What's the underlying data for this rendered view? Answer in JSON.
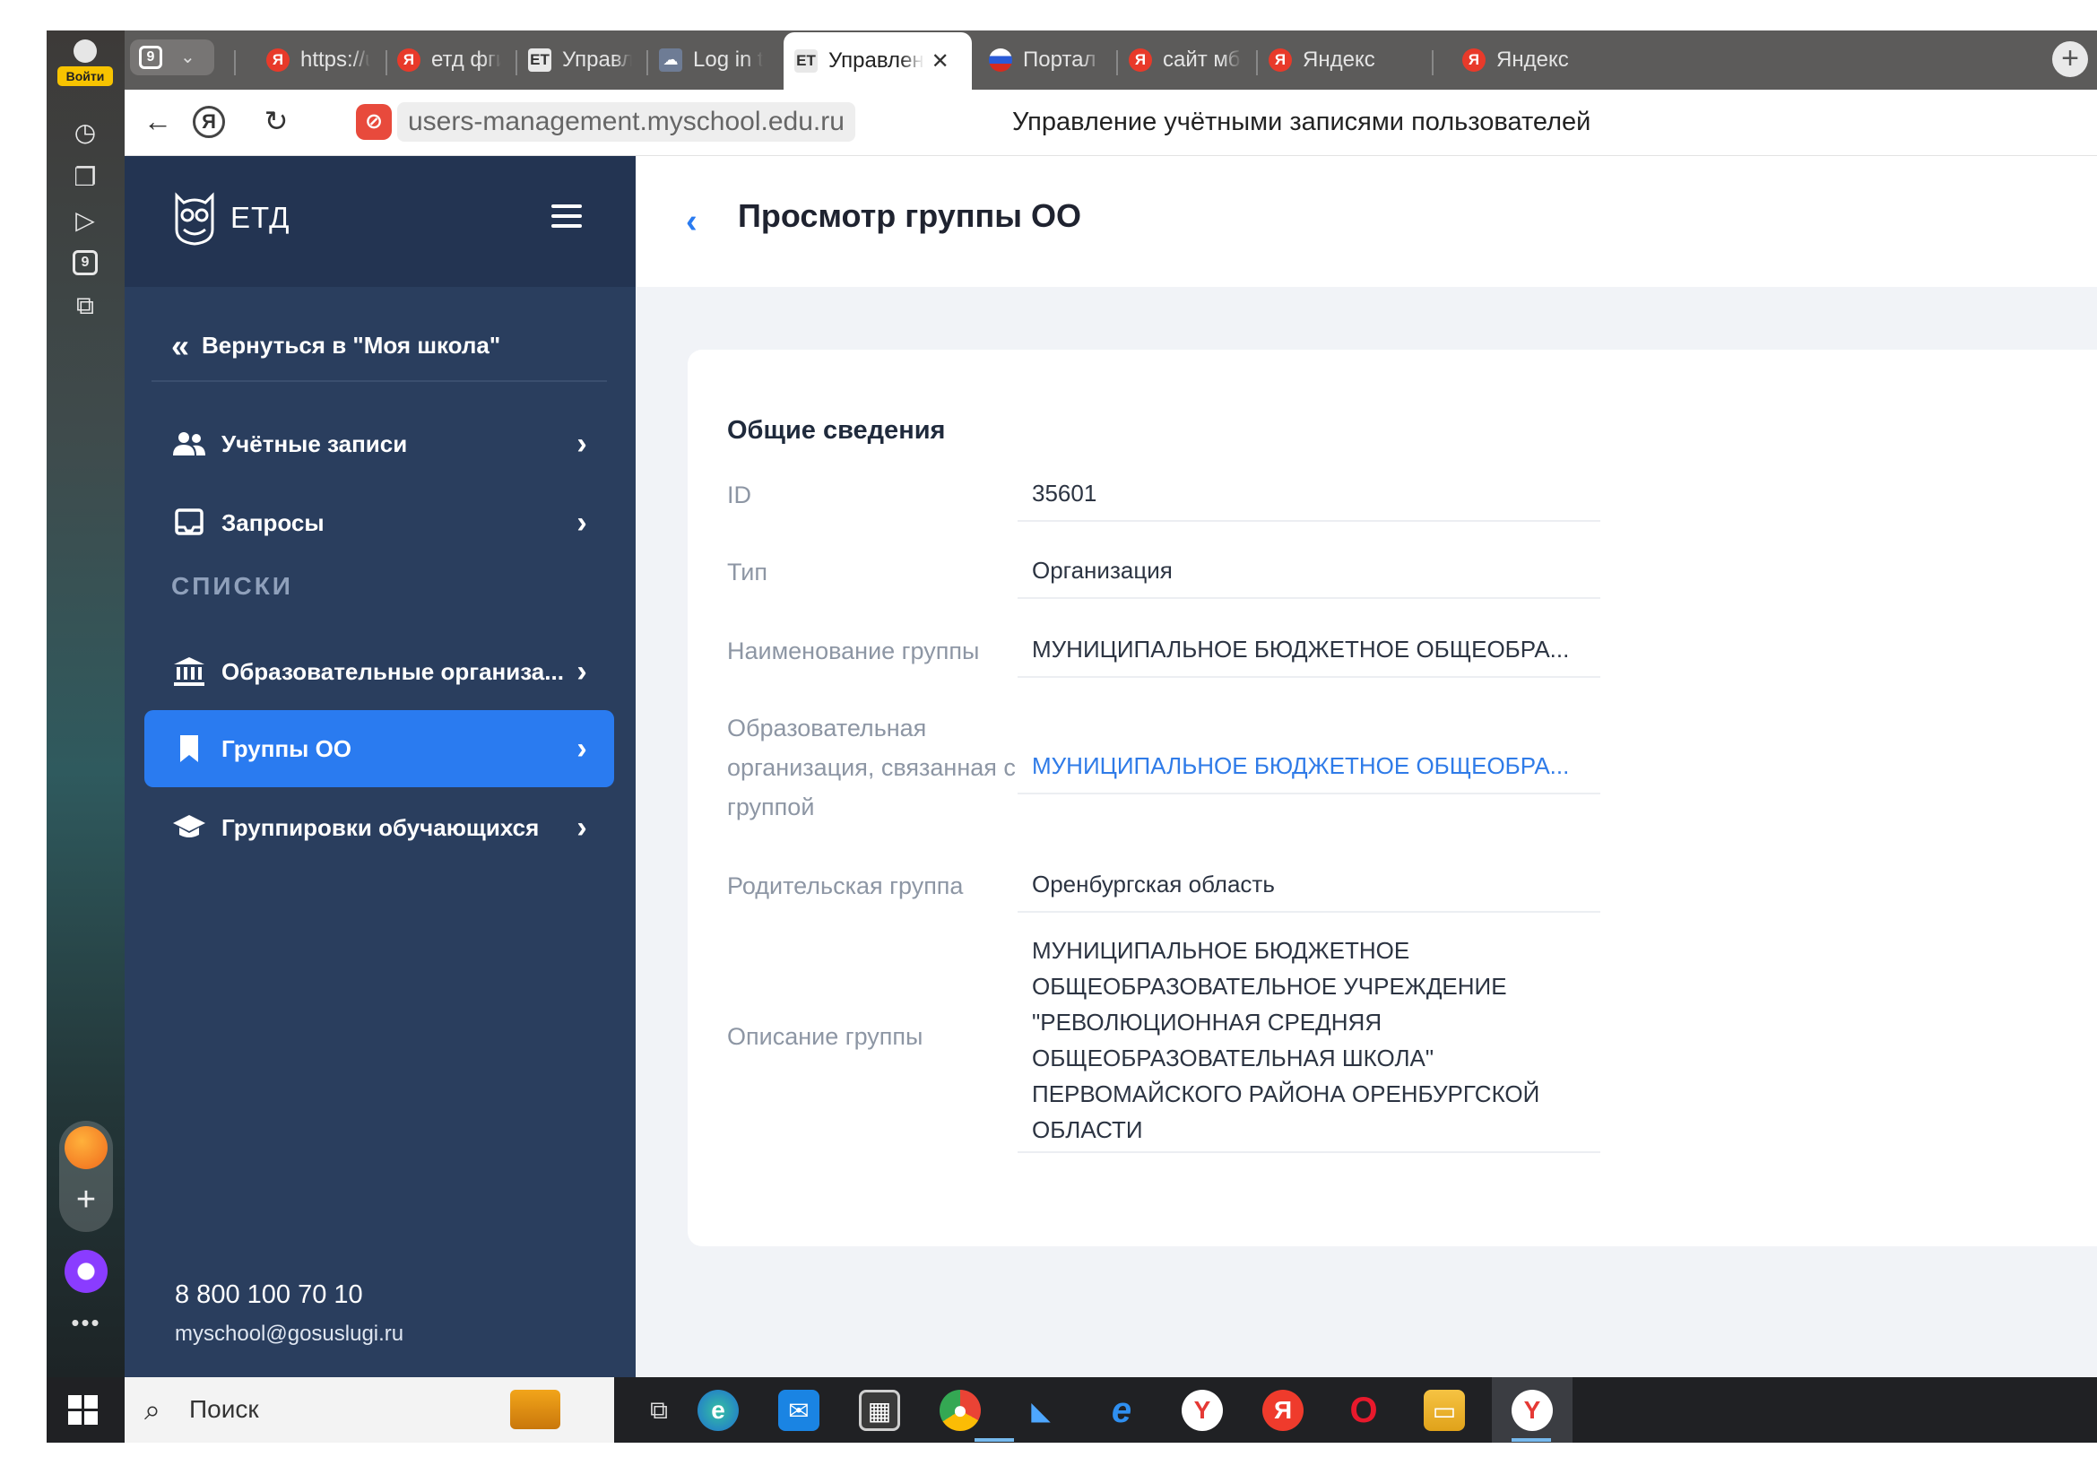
{
  "rail": {
    "login_label": "Войти",
    "tabs_count": "9",
    "icons": [
      "history-icon",
      "collections-icon",
      "video-icon",
      "counter-icon",
      "screenshot-icon"
    ]
  },
  "tabs": [
    {
      "title": "https://users",
      "favicon": "ya"
    },
    {
      "title": "етд фгис мо",
      "favicon": "ya"
    },
    {
      "title": "Управление",
      "favicon": "doc"
    },
    {
      "title": "Log in to etd",
      "favicon": "cloud"
    },
    {
      "title": "Управлен",
      "favicon": "doc",
      "active": true
    },
    {
      "title": "Портал госу",
      "favicon": "ru"
    },
    {
      "title": "сайт мбоу с",
      "favicon": "ya"
    },
    {
      "title": "Яндекс",
      "favicon": "ya"
    },
    {
      "title": "Яндекс",
      "favicon": "ya"
    }
  ],
  "address": {
    "url": "users-management.myschool.edu.ru",
    "page_title": "Управление учётными записями пользователей"
  },
  "sidebar": {
    "logo": "ЕТД",
    "back": "Вернуться в \"Моя школа\"",
    "items": [
      {
        "label": "Учётные записи",
        "icon": "users-icon"
      },
      {
        "label": "Запросы",
        "icon": "inbox-icon"
      }
    ],
    "section": "СПИСКИ",
    "lists": [
      {
        "label": "Образовательные организа...",
        "icon": "institution-icon"
      },
      {
        "label": "Группы ОО",
        "icon": "bookmark-icon",
        "active": true
      },
      {
        "label": "Группировки обучающихся",
        "icon": "graduation-cap-icon"
      }
    ],
    "phone": "8 800 100 70 10",
    "email": "myschool@gosuslugi.ru"
  },
  "main": {
    "title": "Просмотр группы ОО",
    "card_title": "Общие сведения",
    "rows": [
      {
        "label": "ID",
        "value": "35601"
      },
      {
        "label": "Тип",
        "value": "Организация"
      },
      {
        "label": "Наименование группы",
        "value": "МУНИЦИПАЛЬНОЕ БЮДЖЕТНОЕ ОБЩЕОБРА..."
      },
      {
        "label": "Образовательная организация, связанная с группой",
        "value": "МУНИЦИПАЛЬНОЕ БЮДЖЕТНОЕ ОБЩЕОБРА...",
        "link": true
      },
      {
        "label": "Родительская группа",
        "value": "Оренбургская область"
      },
      {
        "label": "Описание группы",
        "value": "МУНИЦИПАЛЬНОЕ БЮДЖЕТНОЕ ОБЩЕОБРАЗОВАТЕЛЬНОЕ УЧРЕЖДЕНИЕ \"РЕВОЛЮЦИОННАЯ СРЕДНЯЯ ОБЩЕОБРАЗОВАТЕЛЬНАЯ ШКОЛА\" ПЕРВОМАЙСКОГО РАЙОНА ОРЕНБУРГСКОЙ ОБЛАСТИ"
      }
    ]
  },
  "taskbar": {
    "search_label": "Поиск",
    "apps": [
      "task-view-icon",
      "edge-icon",
      "mail-icon",
      "store-icon",
      "chrome-icon",
      "app-icon",
      "ie-icon",
      "yandex-browser-icon",
      "yandex-icon",
      "opera-icon",
      "explorer-icon",
      "yandex-active-icon"
    ]
  },
  "colors": {
    "accent": "#2a7bf0",
    "sidebar": "#2a3e5e",
    "link": "#2f7be8"
  }
}
